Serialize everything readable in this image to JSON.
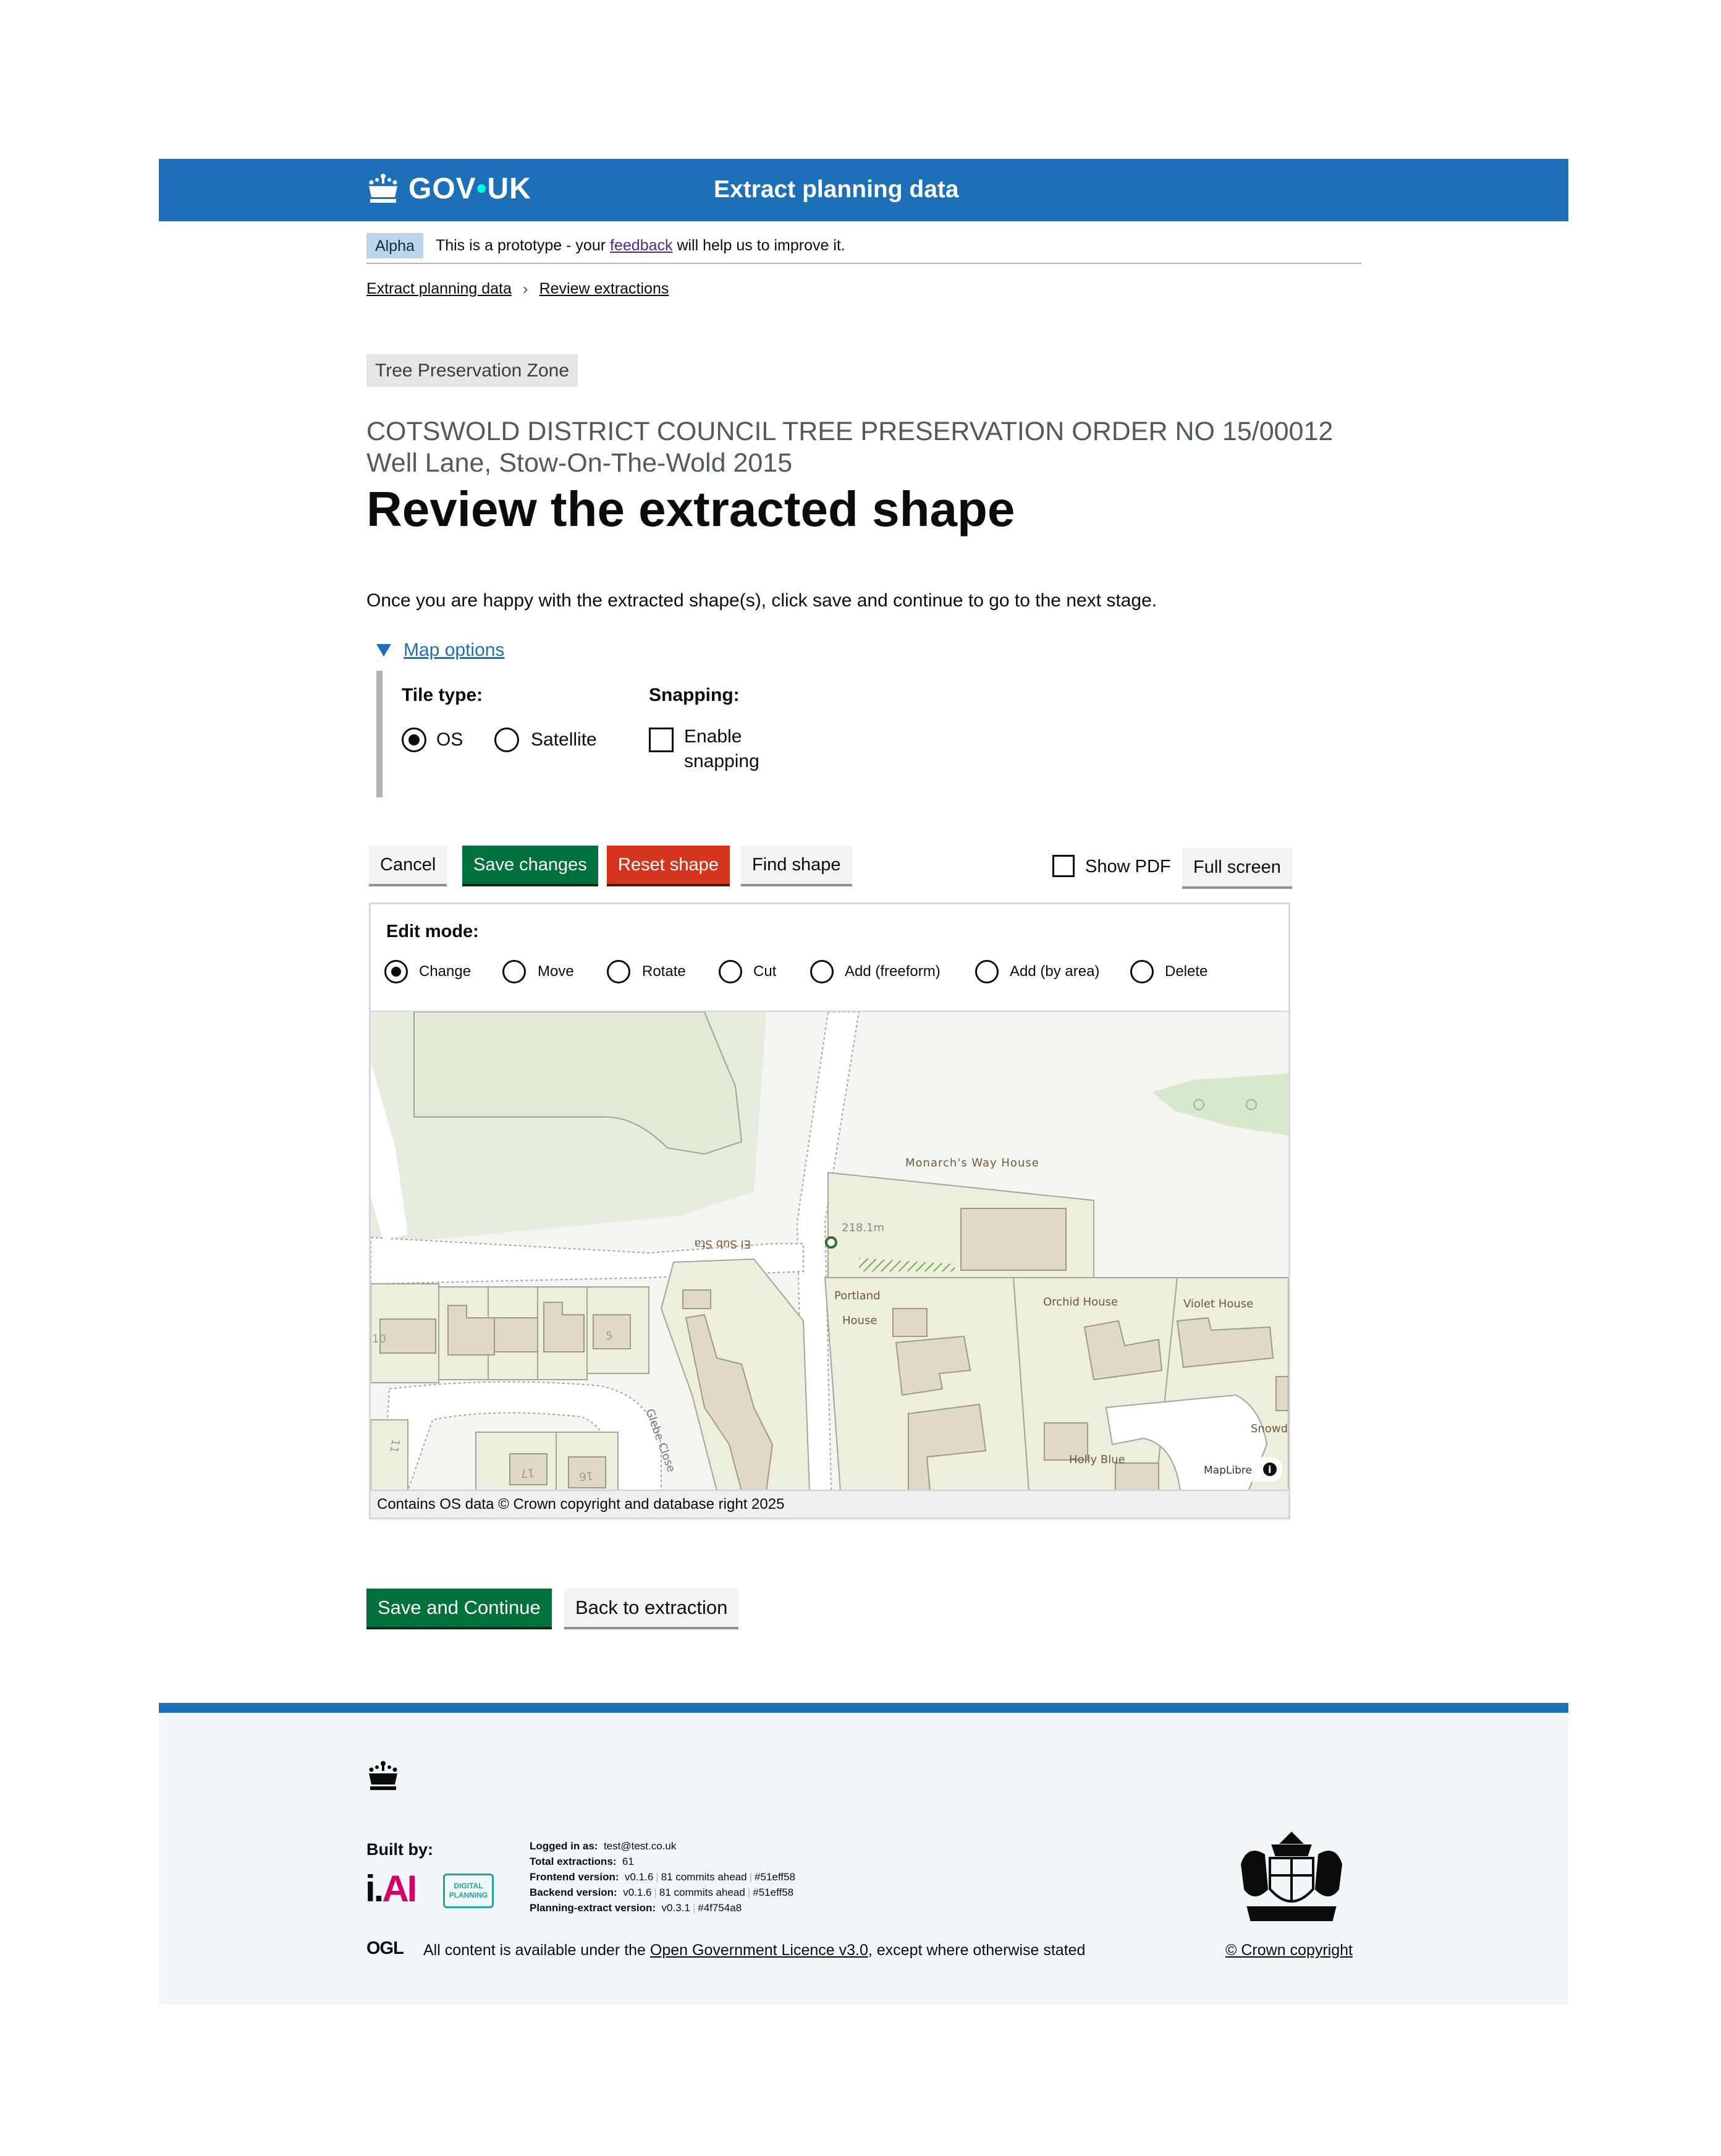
{
  "header": {
    "logo_text": "GOV",
    "logo_text_2": "UK",
    "service_name": "Extract planning data"
  },
  "phase": {
    "tag": "Alpha",
    "text_before": "This is a prototype - your",
    "link": "feedback",
    "text_after": "will help us to improve it."
  },
  "breadcrumbs": [
    "Extract planning data",
    "Review extractions"
  ],
  "page": {
    "tag": "Tree Preservation Zone",
    "caption": "COTSWOLD DISTRICT COUNCIL TREE PRESERVATION ORDER NO 15/00012 Well Lane, Stow-On-The-Wold 2015",
    "title": "Review the extracted shape",
    "intro": "Once you are happy with the extracted shape(s), click save and continue to go to the next stage."
  },
  "map_options": {
    "summary": "Map options",
    "tile_type_label": "Tile type:",
    "tile_options": [
      {
        "label": "OS",
        "checked": true
      },
      {
        "label": "Satellite",
        "checked": false
      }
    ],
    "snapping_label": "Snapping:",
    "snapping_option_1": "Enable",
    "snapping_option_2": "snapping"
  },
  "toolbar": {
    "cancel": "Cancel",
    "save_changes": "Save changes",
    "reset_shape": "Reset shape",
    "find_shape": "Find shape",
    "show_pdf": "Show PDF",
    "full_screen": "Full screen"
  },
  "edit_mode": {
    "label": "Edit mode:",
    "options": [
      "Change",
      "Move",
      "Rotate",
      "Cut",
      "Add (freeform)",
      "Add (by area)",
      "Delete"
    ],
    "selected": "Change"
  },
  "map": {
    "labels": {
      "monarchs": "Monarch's Way House",
      "spot_height": "218.1m",
      "street": "El Sub Sta",
      "portland_1": "Portland",
      "portland_2": "House",
      "orchid": "Orchid House",
      "violet": "Violet House",
      "snowd": "Snowd",
      "holly": "Holly Blue",
      "glebe": "Glebe Close",
      "n10": "10",
      "n5": "5",
      "n11": "11",
      "n17": "17",
      "n16": "16"
    },
    "maplibre": "MapLibre",
    "attribution": "Contains OS data © Crown copyright and database right 2025",
    "colors": {
      "greenspace": "#e3ecd9",
      "building": "#dedbc6",
      "plot": "#eeeedf",
      "road": "#ffffff",
      "hatch": "#7aa64f"
    }
  },
  "actions": {
    "save_continue": "Save and Continue",
    "back": "Back to extraction"
  },
  "footer": {
    "built_by": "Built by:",
    "iai_i": "i.",
    "iai_ai": "AI",
    "dp_1": "DIGITAL",
    "dp_2": "PLANNING",
    "logged_in_label": "Logged in as:",
    "logged_in_value": "test@test.co.uk",
    "total_label": "Total extractions:",
    "total_value": "61",
    "frontend_label": "Frontend version:",
    "frontend_v": "v0.1.6",
    "frontend_commits": "81 commits ahead",
    "frontend_hash": "#51eff58",
    "backend_label": "Backend version:",
    "backend_v": "v0.1.6",
    "backend_commits": "81 commits ahead",
    "backend_hash": "#51eff58",
    "planning_label": "Planning-extract version:",
    "planning_v": "v0.3.1",
    "planning_hash": "#4f754a8",
    "ogl": "OGL",
    "licence_before": "All content is available under the",
    "licence_link": "Open Government Licence v3.0",
    "licence_after": ", except where otherwise stated",
    "crown_copyright": "© Crown copyright"
  }
}
